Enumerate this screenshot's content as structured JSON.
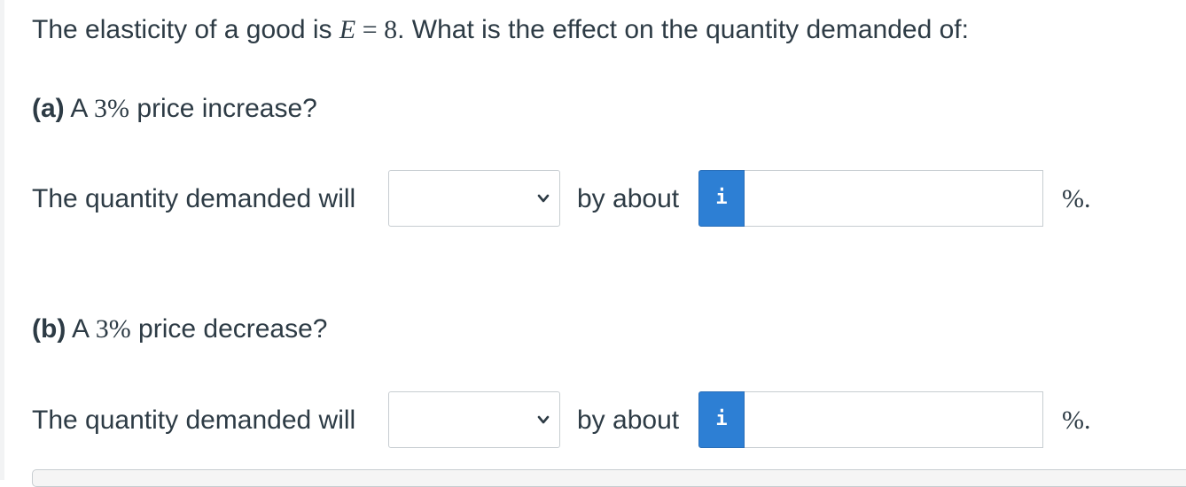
{
  "question": {
    "intro_prefix": "The elasticity of a good is ",
    "elasticity_symbol": "E",
    "equals": " = ",
    "elasticity_value": "8",
    "intro_suffix": ". What is the effect on the quantity demanded of:"
  },
  "part_a": {
    "label": "(a)",
    "text_prefix": " A ",
    "percent": "3%",
    "text_suffix": " price increase?",
    "answer_lead": "The quantity demanded will",
    "select_value": "",
    "by_about": "by about",
    "info_icon": "i",
    "input_value": "",
    "unit": "%."
  },
  "part_b": {
    "label": "(b)",
    "text_prefix": " A ",
    "percent": "3%",
    "text_suffix": " price decrease?",
    "answer_lead": "The quantity demanded will",
    "select_value": "",
    "by_about": "by about",
    "info_icon": "i",
    "input_value": "",
    "unit": "%."
  },
  "colors": {
    "info_button": "#2d7fd4",
    "text": "#2d3b45",
    "border": "#c7cdd1"
  }
}
